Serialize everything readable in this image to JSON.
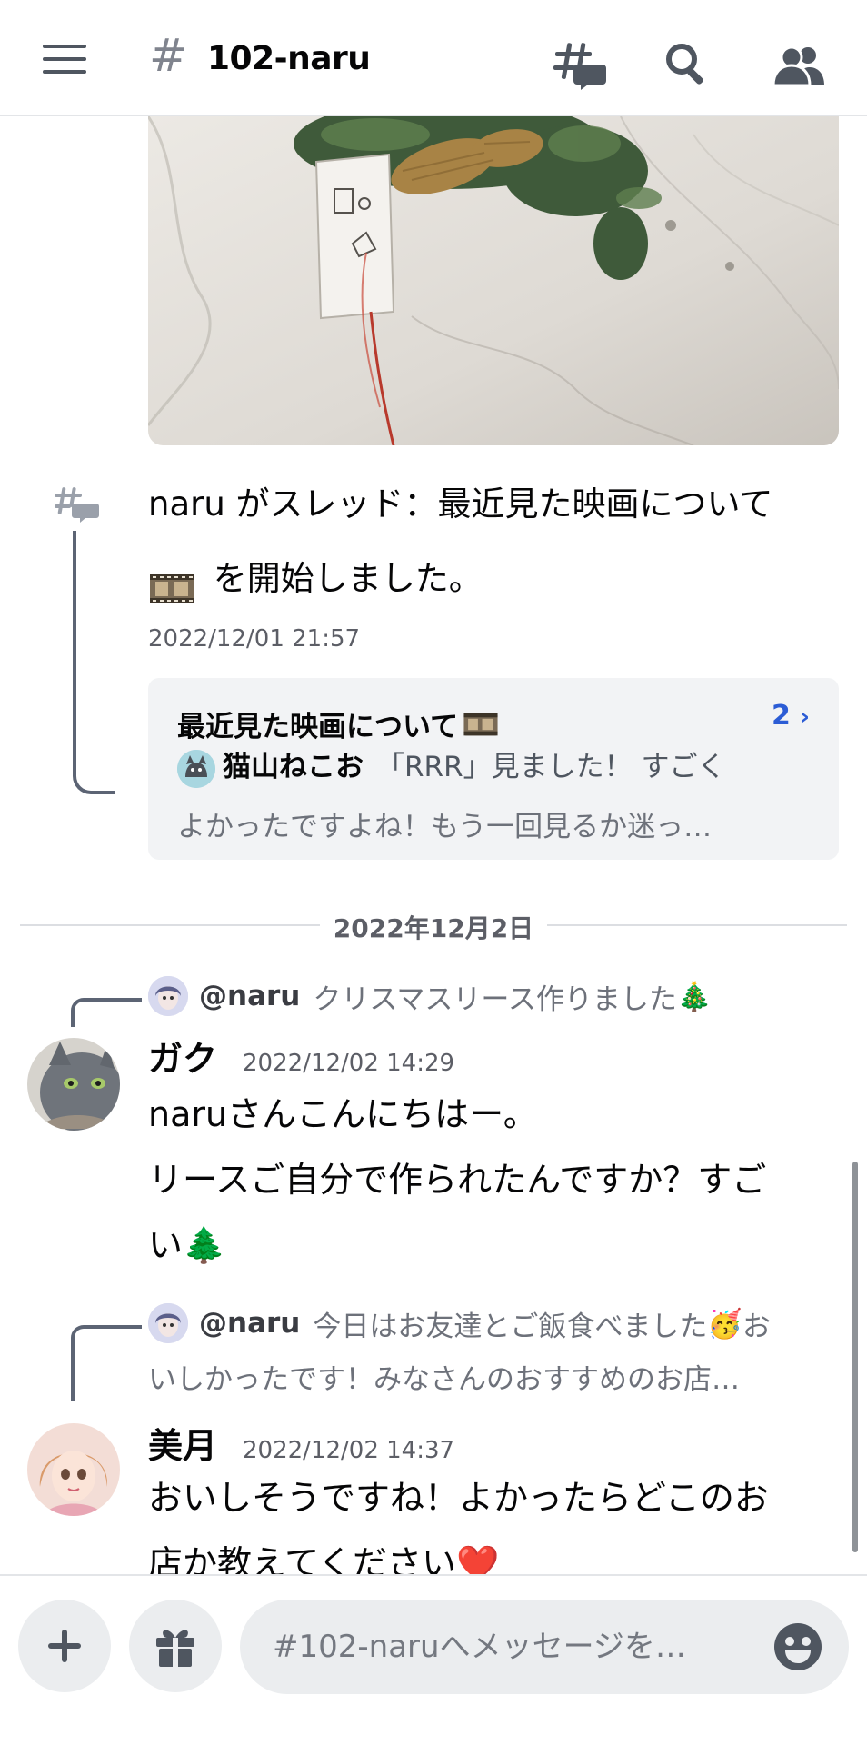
{
  "header": {
    "channel_name": "102-naru",
    "hash": "#",
    "icons": [
      "hamburger-menu-icon",
      "threads-icon",
      "search-icon",
      "members-icon"
    ]
  },
  "system_message": {
    "user": "naru",
    "text_before": " がスレッド：最近見た映画について",
    "text_after": " を開始しました。",
    "timestamp": "2022/12/01 21:57"
  },
  "thread_card": {
    "name": "最近見た映画について",
    "count": "2",
    "count_chevron": "›",
    "last_author": "猫山ねこお",
    "last_message_line1": "「RRR」見ました！ すごく",
    "last_message_line2": "よかったですよね！もう一回見るか迷っ…"
  },
  "date_divider": "2022年12月2日",
  "messages": [
    {
      "reply_mention": "@naru",
      "reply_preview": "クリスマスリース作りました",
      "reply_emoji": "🎄",
      "author": "ガク",
      "timestamp": "2022/12/02 14:29",
      "line1": "naruさんこんにちはー。",
      "line2": "リースご自分で作られたんですか？すご",
      "line3": "い",
      "line3_emoji": "🌲"
    },
    {
      "reply_mention": "@naru",
      "reply_preview_a": "今日はお友達とご飯食べました",
      "reply_emoji": "🥳",
      "reply_preview_b": "お",
      "reply_preview_line2": "いしかったです！みなさんのおすすめのお店…",
      "author": "美月",
      "timestamp": "2022/12/02 14:37",
      "line1": "おいしそうですね！よかったらどこのお",
      "line2": "店か教えてください",
      "line2_emoji": "❤️"
    }
  ],
  "composer": {
    "placeholder": "#102-naruへメッセージを…",
    "icons": [
      "plus-icon",
      "gift-icon",
      "emoji-icon"
    ]
  },
  "colors": {
    "accent_link": "#2c5cd5",
    "muted_text": "#6d717a",
    "card_bg": "#f2f3f5",
    "input_bg": "#ebedef"
  }
}
